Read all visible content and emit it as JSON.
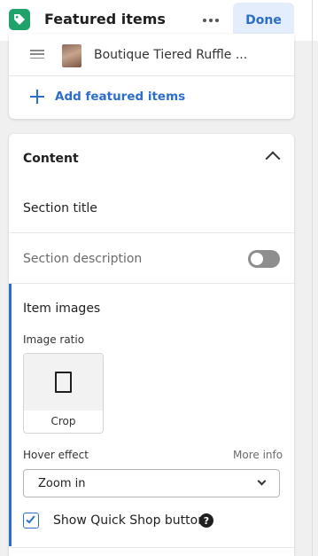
{
  "header": {
    "title": "Featured items",
    "done_label": "Done",
    "more_icon": "more-horizontal-icon",
    "app_icon": "tag-icon",
    "accent_color": "#1fa36b"
  },
  "featured": {
    "items": [
      {
        "name": "Boutique Tiered Ruffle ..."
      }
    ],
    "add_label": "Add featured items"
  },
  "content": {
    "heading": "Content",
    "section_title_label": "Section title",
    "section_description_label": "Section description",
    "section_description_enabled": false,
    "item_images": {
      "title": "Item images",
      "image_ratio_label": "Image ratio",
      "ratio_option": "Crop",
      "hover_effect_label": "Hover effect",
      "more_info_label": "More info",
      "hover_effect_value": "Zoom in",
      "quick_shop_label": "Show Quick Shop button",
      "quick_shop_checked": true,
      "help_glyph": "?"
    }
  },
  "colors": {
    "link": "#2c6ecb",
    "done_bg": "#e4edfb",
    "toggle_off": "#8e8e8e"
  }
}
